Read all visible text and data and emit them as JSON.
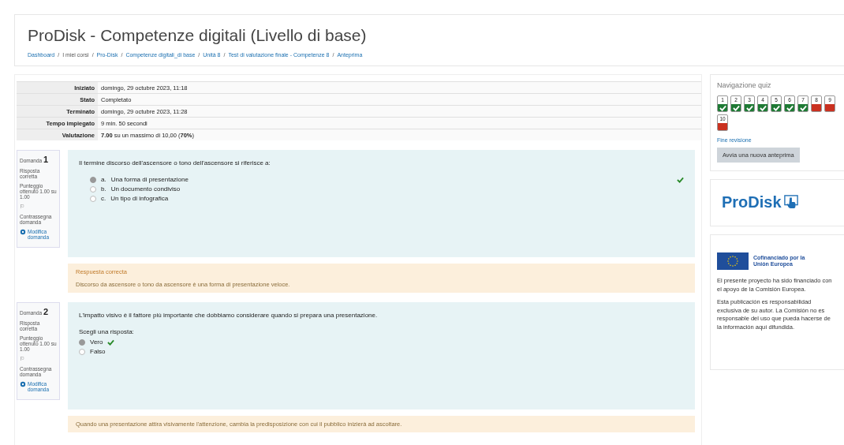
{
  "header": {
    "title": "ProDisk - Competenze digitali (Livello di base)",
    "breadcrumb": [
      {
        "kind": "link",
        "label": "Dashboard"
      },
      {
        "kind": "separator",
        "label": "/"
      },
      {
        "kind": "text",
        "label": "I miei corsi"
      },
      {
        "kind": "separator",
        "label": "/"
      },
      {
        "kind": "link",
        "label": "Pro-Disk"
      },
      {
        "kind": "separator",
        "label": "/"
      },
      {
        "kind": "link",
        "label": "Competenze digitali_di base"
      },
      {
        "kind": "separator",
        "label": "/"
      },
      {
        "kind": "link",
        "label": "Unità 8"
      },
      {
        "kind": "separator",
        "label": "/"
      },
      {
        "kind": "link",
        "label": "Test di valutazione finale - Competenze 8"
      },
      {
        "kind": "separator",
        "label": "/"
      },
      {
        "kind": "link",
        "label": "Anteprima"
      }
    ]
  },
  "summary": [
    {
      "label": "Iniziato",
      "value": "domingo, 29 octubre 2023, 11:18"
    },
    {
      "label": "Stato",
      "value": "Completato"
    },
    {
      "label": "Terminato",
      "value": "domingo, 29 octubre 2023, 11:28"
    },
    {
      "label": "Tempo impiegato",
      "value": "9 min. 50 secondi"
    },
    {
      "label": "Valutazione",
      "value": "**7.00** su un massimo di 10,00 (**70%**)"
    }
  ],
  "questions": [
    {
      "kind": "multichoice",
      "label": "Domanda",
      "number": "1",
      "status": "Risposta corretta",
      "score": "Punteggio ottenuto 1.00 su 1.00",
      "flag_icon": "⚐",
      "flag": "Contrassegna domanda",
      "edit": "Modifica domanda",
      "text": "Il termine discorso dell'ascensore o tono dell'ascensore si riferisce a:",
      "options": [
        {
          "letter": "a.",
          "text": "Una forma di presentazione",
          "selected": true,
          "correct": true
        },
        {
          "letter": "b.",
          "text": "Un documento condiviso",
          "selected": false,
          "correct": false
        },
        {
          "letter": "c.",
          "text": "Un tipo di infografica",
          "selected": false,
          "correct": false
        }
      ],
      "feedback": {
        "title": "Respuesta correcta",
        "text": "Discorso da ascensore o tono da ascensore è una forma di presentazione veloce."
      }
    },
    {
      "kind": "truefalse",
      "label": "Domanda",
      "number": "2",
      "status": "Risposta corretta",
      "score": "Punteggio ottenuto 1.00 su 1.00",
      "flag_icon": "⚐",
      "flag": "Contrassegna domanda",
      "edit": "Modifica domanda",
      "text": "L'impatto visivo è il fattore più importante che dobbiamo considerare quando si prepara una presentazione.",
      "prompt": "Scegli una risposta:",
      "options": [
        {
          "text": "Vero",
          "selected": true,
          "correct": true
        },
        {
          "text": "Falso",
          "selected": false,
          "correct": false
        }
      ],
      "feedback": {
        "text": "Quando una presentazione attira visivamente l'attenzione, cambia la predisposizione con cui il pubblico inizierà ad ascoltare."
      }
    }
  ],
  "quiz_nav": {
    "title": "Navigazione quiz",
    "items": [
      {
        "number": "1",
        "correct": true
      },
      {
        "number": "2",
        "correct": true
      },
      {
        "number": "3",
        "correct": true
      },
      {
        "number": "4",
        "correct": true
      },
      {
        "number": "5",
        "correct": true
      },
      {
        "number": "6",
        "correct": true
      },
      {
        "number": "7",
        "correct": true
      },
      {
        "number": "8",
        "correct": false
      },
      {
        "number": "9",
        "correct": false
      },
      {
        "number": "10",
        "correct": false
      }
    ],
    "finish_link": "Fine revisione",
    "new_preview_button": "Avvia una nuova anteprima"
  },
  "logo": {
    "text": "ProDisk"
  },
  "funding": {
    "eu_label": "Cofinanciado por la Unión Europea",
    "paragraphs": [
      "El presente proyecto ha sido financiado con el apoyo de la Comisión Europea.",
      "Esta publicación es responsabilidad exclusiva de su autor. La Comisión no es responsable del uso que pueda hacerse de la información aquí difundida."
    ]
  }
}
